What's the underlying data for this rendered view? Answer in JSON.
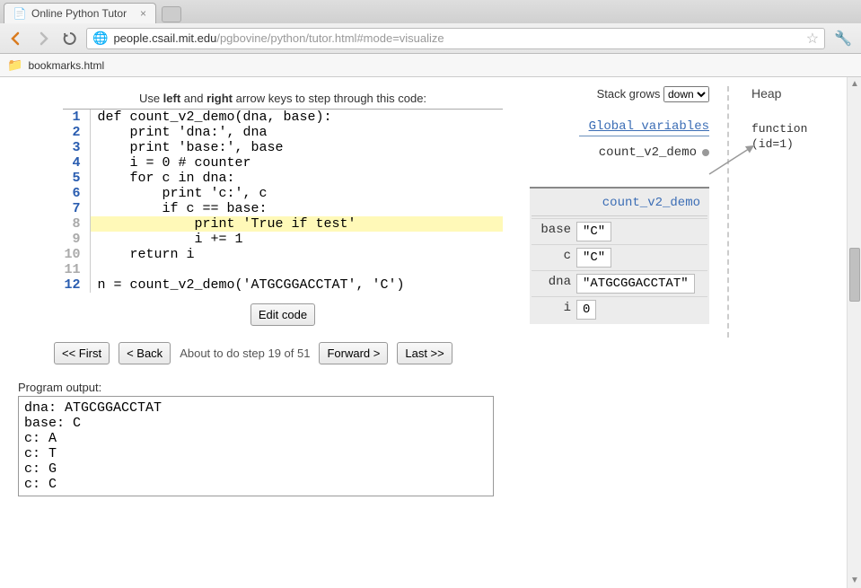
{
  "browser": {
    "tab_title": "Online Python Tutor",
    "url_host": "people.csail.mit.edu",
    "url_path": "/pgbovine/python/tutor.html#mode=visualize",
    "bookmark": "bookmarks.html"
  },
  "instructions_prefix": "Use ",
  "instructions_left": "left",
  "instructions_mid": " and ",
  "instructions_right": "right",
  "instructions_suffix": " arrow keys to step through this code:",
  "code": {
    "lines": [
      {
        "n": "1",
        "grey": false,
        "hl": false,
        "text": "def count_v2_demo(dna, base):"
      },
      {
        "n": "2",
        "grey": false,
        "hl": false,
        "text": "    print 'dna:', dna"
      },
      {
        "n": "3",
        "grey": false,
        "hl": false,
        "text": "    print 'base:', base"
      },
      {
        "n": "4",
        "grey": false,
        "hl": false,
        "text": "    i = 0 # counter"
      },
      {
        "n": "5",
        "grey": false,
        "hl": false,
        "text": "    for c in dna:"
      },
      {
        "n": "6",
        "grey": false,
        "hl": false,
        "text": "        print 'c:', c"
      },
      {
        "n": "7",
        "grey": false,
        "hl": false,
        "text": "        if c == base:"
      },
      {
        "n": "8",
        "grey": true,
        "hl": true,
        "text": "            print 'True if test'"
      },
      {
        "n": "9",
        "grey": true,
        "hl": false,
        "text": "            i += 1"
      },
      {
        "n": "10",
        "grey": true,
        "hl": false,
        "text": "    return i"
      },
      {
        "n": "11",
        "grey": true,
        "hl": false,
        "text": ""
      },
      {
        "n": "12",
        "grey": false,
        "hl": false,
        "text": "n = count_v2_demo('ATGCGGACCTAT', 'C')"
      }
    ]
  },
  "buttons": {
    "edit_code": "Edit code",
    "first": "<< First",
    "back": "< Back",
    "forward": "Forward >",
    "last": "Last >>"
  },
  "step_text": "About to do step 19 of 51",
  "output": {
    "label": "Program output:",
    "text": "dna: ATGCGGACCTAT\nbase: C\nc: A\nc: T\nc: G\nc: C"
  },
  "stack": {
    "grows_label": "Stack grows",
    "grows_value": "down",
    "globals_label": "Global variables",
    "global_var": "count_v2_demo"
  },
  "heap": {
    "title": "Heap",
    "obj_line1": "function",
    "obj_line2": "(id=1)"
  },
  "frame": {
    "title": "count_v2_demo",
    "rows": [
      {
        "key": "base",
        "val": "\"C\""
      },
      {
        "key": "c",
        "val": "\"C\""
      },
      {
        "key": "dna",
        "val": "\"ATGCGGACCTAT\""
      },
      {
        "key": "i",
        "val": "0"
      }
    ]
  }
}
